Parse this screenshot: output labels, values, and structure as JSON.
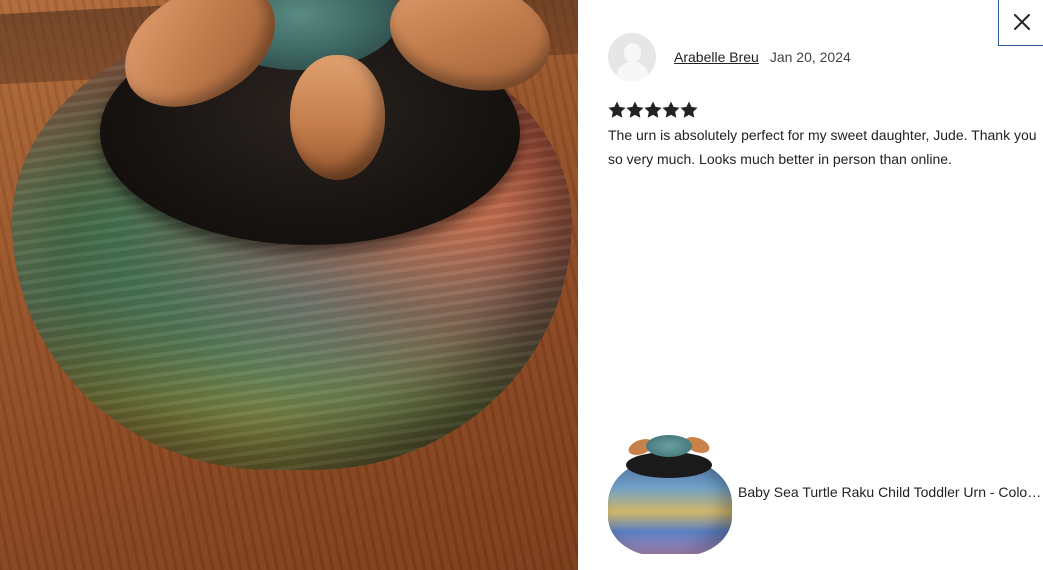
{
  "dialog": {
    "close_icon": "close-icon"
  },
  "review": {
    "reviewer_name": "Arabelle Breu",
    "date": "Jan 20, 2024",
    "rating": 5,
    "rating_max": 5,
    "star_color": "#222222",
    "text": "The urn is absolutely perfect for my sweet daughter, Jude. Thank you so very much. Looks much better in person than online."
  },
  "product": {
    "title": "Baby Sea Turtle Raku Child Toddler Urn - Color Varies"
  }
}
